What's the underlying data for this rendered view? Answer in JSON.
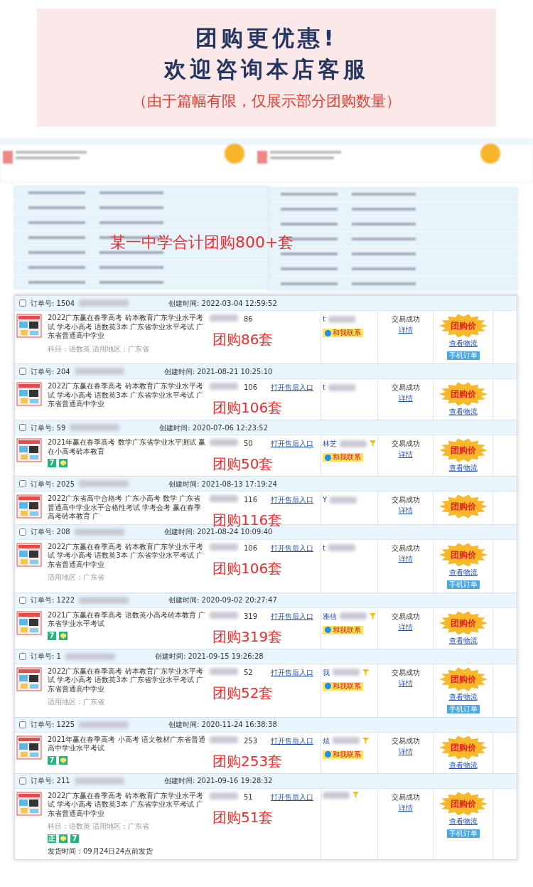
{
  "banner": {
    "title_lines": [
      "团购更优惠!",
      "欢迎咨询本店客服"
    ],
    "note": "（由于篇幅有限，仅展示部分团购数量）"
  },
  "collage": {
    "caption": "某一中学合计团购800+套"
  },
  "orders": [
    {
      "checked": false,
      "order_no": "订单号: 1504",
      "created": "创建时间: 2022-03-04 12:59:52",
      "title": "2022广东赢在春季高考 砖本教育广东学业水平考试 学考小高考 语数英3本 广东省学业水平考试 广东省普通高中学业",
      "meta": "科目：语数英   适用地区：广东省",
      "qty": "86",
      "buyer": "t",
      "filter": false,
      "contact": "和我联系",
      "status": "交易成功",
      "detail": "详情",
      "deal": "团购价",
      "logistics": "查看物流",
      "phone_order": "手机订单",
      "overlay": "团购86套"
    },
    {
      "checked": false,
      "order_no": "订单号: 204",
      "created": "创建时间: 2021-08-21 10:25:10",
      "title": "2022广东赢在春季高考 砖本教育广东学业水平考试 学考小高考 语数英3本 广东省学业水平考试 广东省普通高中学业",
      "qty": "106",
      "aftersale": "打开售后入口",
      "buyer": "t",
      "filter": false,
      "status": "交易成功",
      "detail": "详情",
      "deal": "团购价",
      "logistics": "查看物流",
      "overlay": "团购106套"
    },
    {
      "checked": false,
      "order_no": "订单号: 59",
      "created": "创建时间: 2020-07-06 12:23:52",
      "title": "2021年赢在春季高考 数学广东省学业水平测试 赢在小高考砖本教育",
      "tags": [
        {
          "kind": "label",
          "text": "7"
        },
        {
          "kind": "emblem"
        }
      ],
      "qty": "50",
      "aftersale": "打开售后入口",
      "buyer": "林芝",
      "filter": true,
      "contact": "和我联系",
      "status": "交易成功",
      "detail": "详情",
      "deal": "团购价",
      "logistics": "查看物流",
      "overlay": "团购50套"
    },
    {
      "checked": false,
      "order_no": "订单号: 2025",
      "created": "创建时间: 2021-08-13 17:19:24",
      "title": "2022广东省高中合格考 广东小高考 数学 广东省普通高中学业水平合格性考试 学考会考 赢在春季高考砖本教育 广",
      "qty": "116",
      "aftersale": "打开售后入口",
      "buyer": "Y",
      "filter": false,
      "status": "交易成功",
      "detail": "详情",
      "deal": "团购价",
      "overlay": "团购116套"
    },
    {
      "checked": false,
      "order_no": "订单号: 208",
      "created": "创建时间: 2021-08-24 10:09:40",
      "title": "2022广东赢在春季高考 砖本教育广东学业水平考试 学考小高考 语数英3本 广东省学业水平考试 广东省普通高中学业",
      "meta": "适用地区：广东省",
      "qty": "106",
      "aftersale": "打开售后入口",
      "buyer": "t",
      "filter": false,
      "status": "交易成功",
      "detail": "详情",
      "deal": "团购价",
      "logistics": "查看物流",
      "phone_order": "手机订单",
      "overlay": "团购106套"
    },
    {
      "checked": false,
      "order_no": "订单号: 1222",
      "created": "创建时间: 2020-09-02 20:27:47",
      "title": "2021广东赢在春季高考 语数英小高考砖本教育 广东省学业水平考试",
      "tags": [
        {
          "kind": "label",
          "text": "7"
        },
        {
          "kind": "emblem"
        }
      ],
      "qty": "319",
      "aftersale": "打开售后入口",
      "buyer": "雅信",
      "filter": true,
      "contact": "和我联系",
      "status": "交易成功",
      "detail": "详情",
      "deal": "团购价",
      "logistics": "查看物流",
      "overlay": "团购319套"
    },
    {
      "checked": false,
      "order_no": "订单号: 1",
      "created": "创建时间: 2021-09-15 19:26:28",
      "title": "2022广东赢在春季高考 砖本教育广东学业水平考试 学考小高考 语数英3本 广东省学业水平考试 广东省普通高中学业",
      "meta": "适用地区：广东省",
      "qty": "52",
      "aftersale": "打开售后入口",
      "buyer": "我",
      "filter": true,
      "contact": "和我联系",
      "status": "交易成功",
      "detail": "详情",
      "deal": "团购价",
      "logistics": "查看物流",
      "phone_order": "手机订单",
      "overlay": "团购52套"
    },
    {
      "checked": false,
      "order_no": "订单号: 1225",
      "created": "创建时间: 2020-11-24 16:38:38",
      "title": "2021年赢在春季高考 小高考 语文教材广东省普通高中学业水平考试",
      "tags": [
        {
          "kind": "label",
          "text": "7"
        },
        {
          "kind": "emblem"
        }
      ],
      "qty": "253",
      "aftersale": "打开售后入口",
      "buyer": "炫",
      "filter": true,
      "contact": "和我联系",
      "status": "交易成功",
      "detail": "详情",
      "deal": "团购价",
      "logistics": "查看物流",
      "overlay": "团购253套"
    },
    {
      "checked": false,
      "order_no": "订单号: 211",
      "created": "创建时间: 2021-09-16 19:28:32",
      "title": "2022广东赢在春季高考 砖本教育广东学业水平考试 学考小高考 语数英3本 广东省学业水平考试 广东省普通高中学业",
      "meta": "科目：语数英   适用地区：广东省",
      "tags": [
        {
          "kind": "label",
          "text": "正"
        },
        {
          "kind": "emblem"
        },
        {
          "kind": "label",
          "text": "7"
        }
      ],
      "ship": "发货时间：09月24日24点前发货",
      "qty": "51",
      "aftersale": "打开售后入口",
      "filter": true,
      "status": "交易成功",
      "detail": "详情",
      "deal": "团购价",
      "logistics": "查看物流",
      "phone_order": "手机订单",
      "overlay": "团购51套"
    }
  ]
}
